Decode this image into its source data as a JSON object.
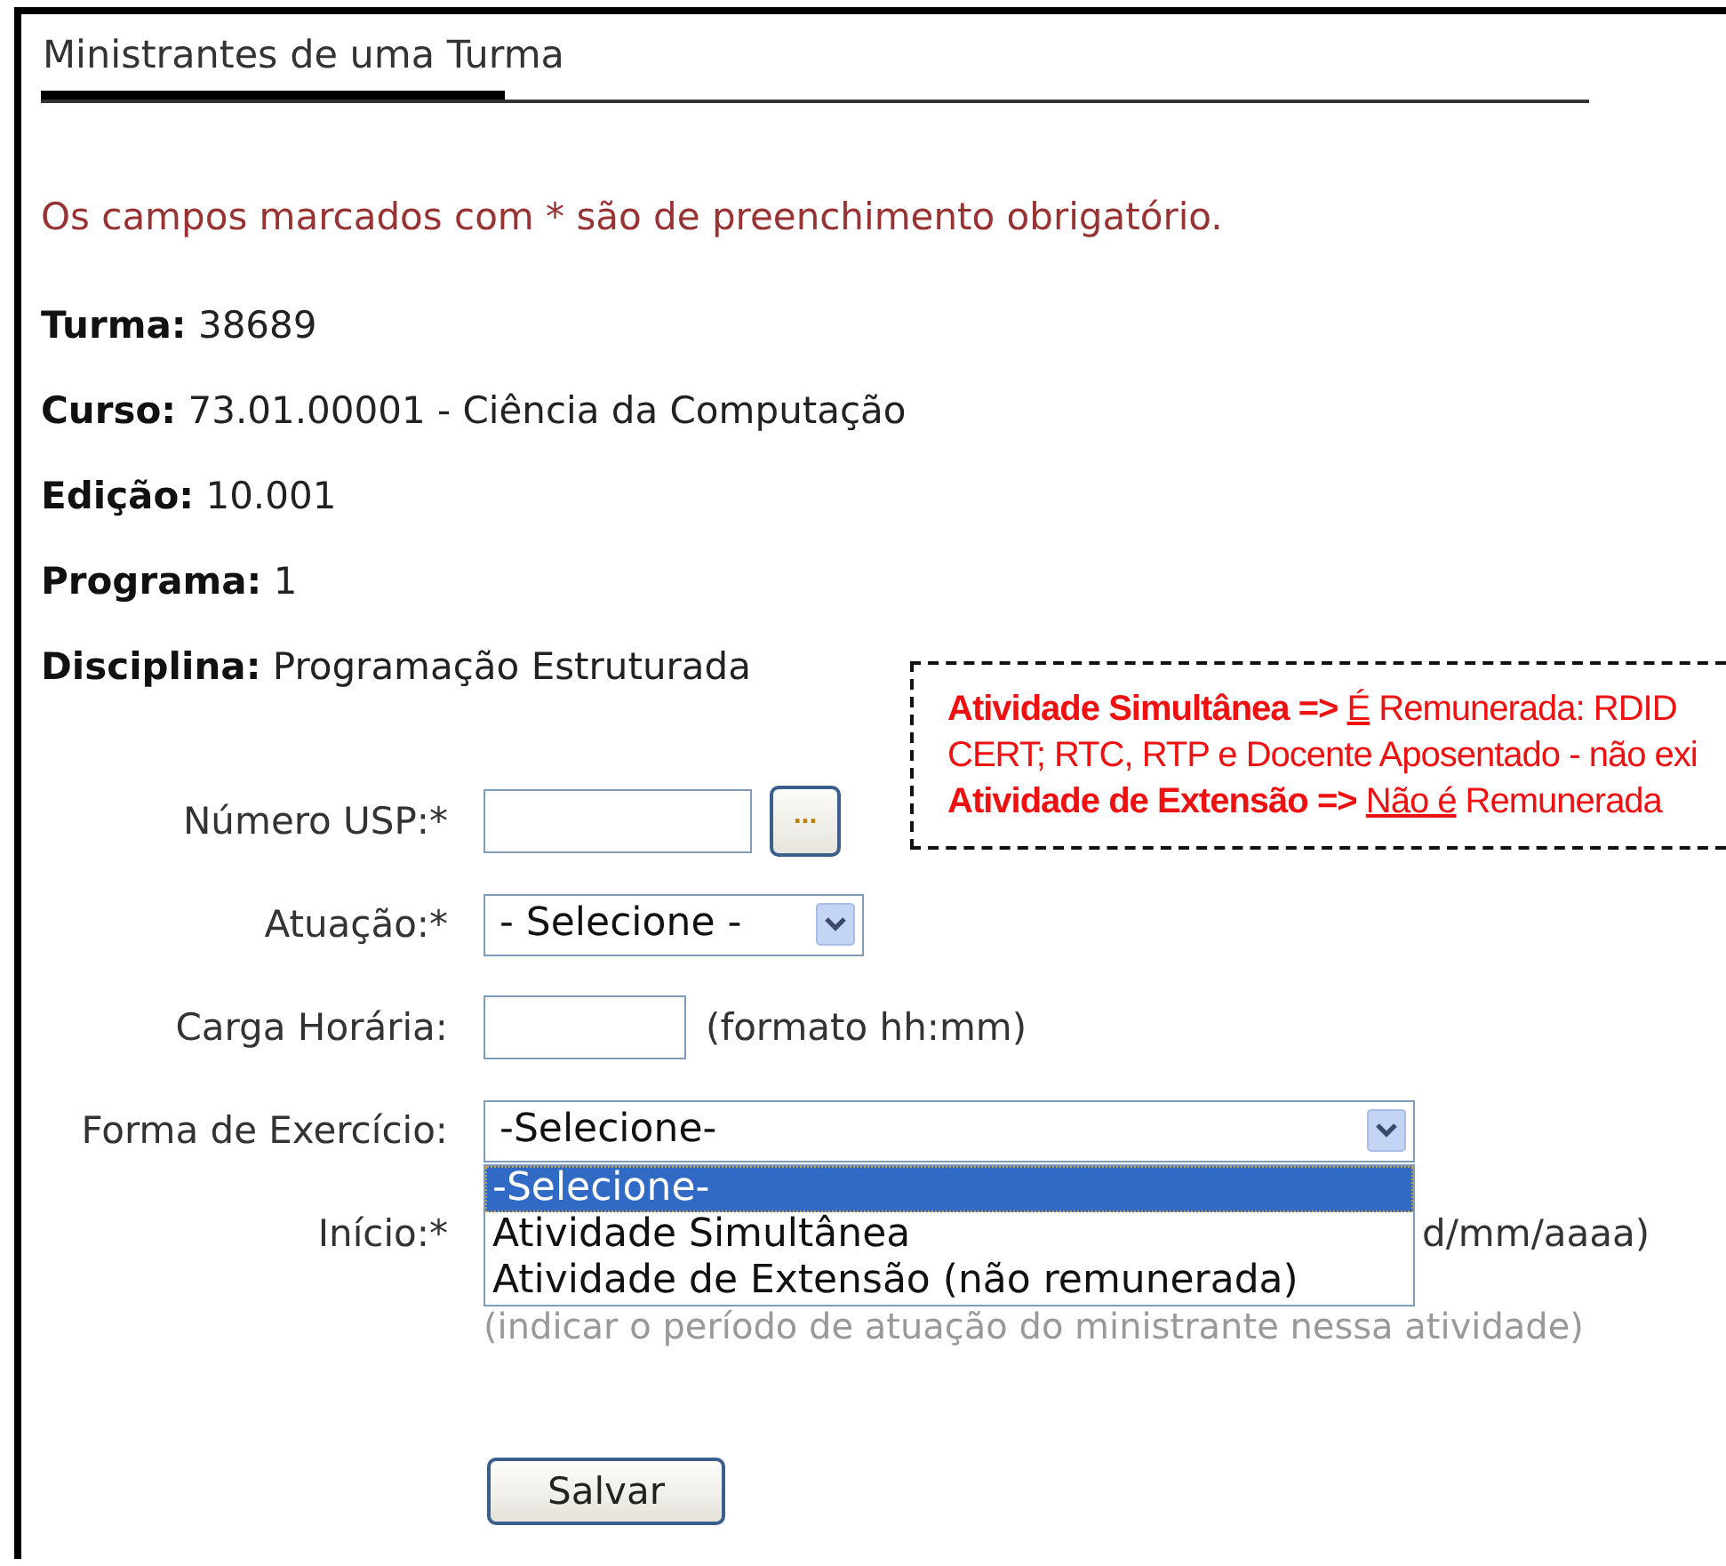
{
  "page": {
    "title": "Ministrantes de uma Turma"
  },
  "required_note": "Os campos marcados com * são de preenchimento obrigatório.",
  "info": [
    {
      "label": "Turma:",
      "value": "38689"
    },
    {
      "label": "Curso:",
      "value": "73.01.00001 - Ciência da Computação"
    },
    {
      "label": "Edição:",
      "value": "10.001"
    },
    {
      "label": "Programa:",
      "value": "1"
    },
    {
      "label": "Disciplina:",
      "value": "Programação Estruturada"
    }
  ],
  "callout": {
    "lines": [
      [
        {
          "text": "Atividade Simultânea => ",
          "kind": "bold"
        },
        {
          "text": "É",
          "kind": "underline"
        },
        {
          "text": " Remunerada: RDID",
          "kind": "normal"
        }
      ],
      [
        {
          "text": "CERT; RTC, RTP e Docente Aposentado - não exi",
          "kind": "normal"
        }
      ],
      [
        {
          "text": "Atividade de Extensão => ",
          "kind": "bold"
        },
        {
          "text": "Não é",
          "kind": "underline"
        },
        {
          "text": " Remunerada",
          "kind": "normal"
        }
      ]
    ]
  },
  "form": {
    "fields": [
      {
        "kind": "text",
        "label": "Número USP:*",
        "button": "..."
      },
      {
        "kind": "select",
        "label": "Atuação:*",
        "value": "- Selecione -"
      },
      {
        "kind": "text",
        "label": "Carga Horária:",
        "hint": "(formato hh:mm)"
      },
      {
        "kind": "select",
        "label": "Forma de Exercício:",
        "value": "-Selecione-",
        "expanded": true,
        "options": [
          {
            "label": "-Selecione-",
            "selected": true
          },
          {
            "label": "Atividade Simultânea",
            "selected": false
          },
          {
            "label": "Atividade de Extensão (não remunerada)",
            "selected": false
          }
        ]
      },
      {
        "kind": "covered",
        "label": "Início:*",
        "hint": "d/mm/aaaa)",
        "note": "(indicar o período de atuação do ministrante nessa atividade)"
      }
    ],
    "submit": "Salvar"
  }
}
